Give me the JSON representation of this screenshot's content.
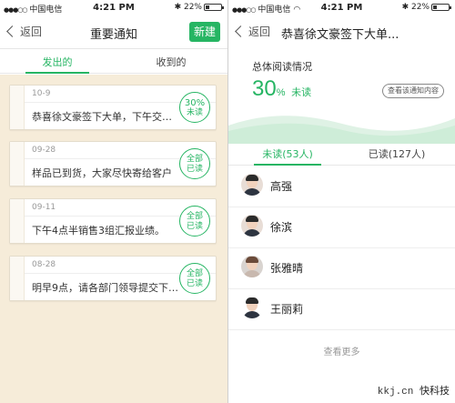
{
  "status_bar": {
    "carrier_left": "中国电信",
    "carrier_right": "中国电信",
    "time": "4:21 PM",
    "battery": "22%",
    "icons": [
      "signal-icon",
      "wifi-icon",
      "bluetooth-icon",
      "battery-icon"
    ]
  },
  "left": {
    "back_label": "返回",
    "title": "重要通知",
    "new_button": "新建",
    "tabs": [
      {
        "label": "发出的",
        "active": true
      },
      {
        "label": "收到的",
        "active": false
      }
    ],
    "cards": [
      {
        "date": "10-9",
        "text": "恭喜徐文豪签下大单，下午交…",
        "badge_top": "30%",
        "badge_bottom": "未读"
      },
      {
        "date": "09-28",
        "text": "样品已到货，大家尽快寄给客户",
        "badge_top": "全部",
        "badge_bottom": "已读"
      },
      {
        "date": "09-11",
        "text": "下午4点半销售3组汇报业绩。",
        "badge_top": "全部",
        "badge_bottom": "已读"
      },
      {
        "date": "08-28",
        "text": "明早9点，请各部门领导提交下…",
        "badge_top": "全部",
        "badge_bottom": "已读"
      }
    ]
  },
  "right": {
    "back_label": "返回",
    "title": "恭喜徐文豪签下大单...",
    "stats_title": "总体阅读情况",
    "percent_number": "30",
    "percent_unit": "%",
    "percent_label": "未读",
    "view_button": "查看该通知内容",
    "tabs": [
      {
        "label": "未读(53人)",
        "active": true
      },
      {
        "label": "已读(127人)",
        "active": false
      }
    ],
    "people": [
      "高强",
      "徐滨",
      "张雅晴",
      "王丽莉"
    ],
    "more": "查看更多"
  },
  "watermark": {
    "domain": "kkj.cn",
    "brand": "快科技"
  },
  "colors": {
    "accent": "#26b563",
    "wood": "#f6ecd9"
  }
}
